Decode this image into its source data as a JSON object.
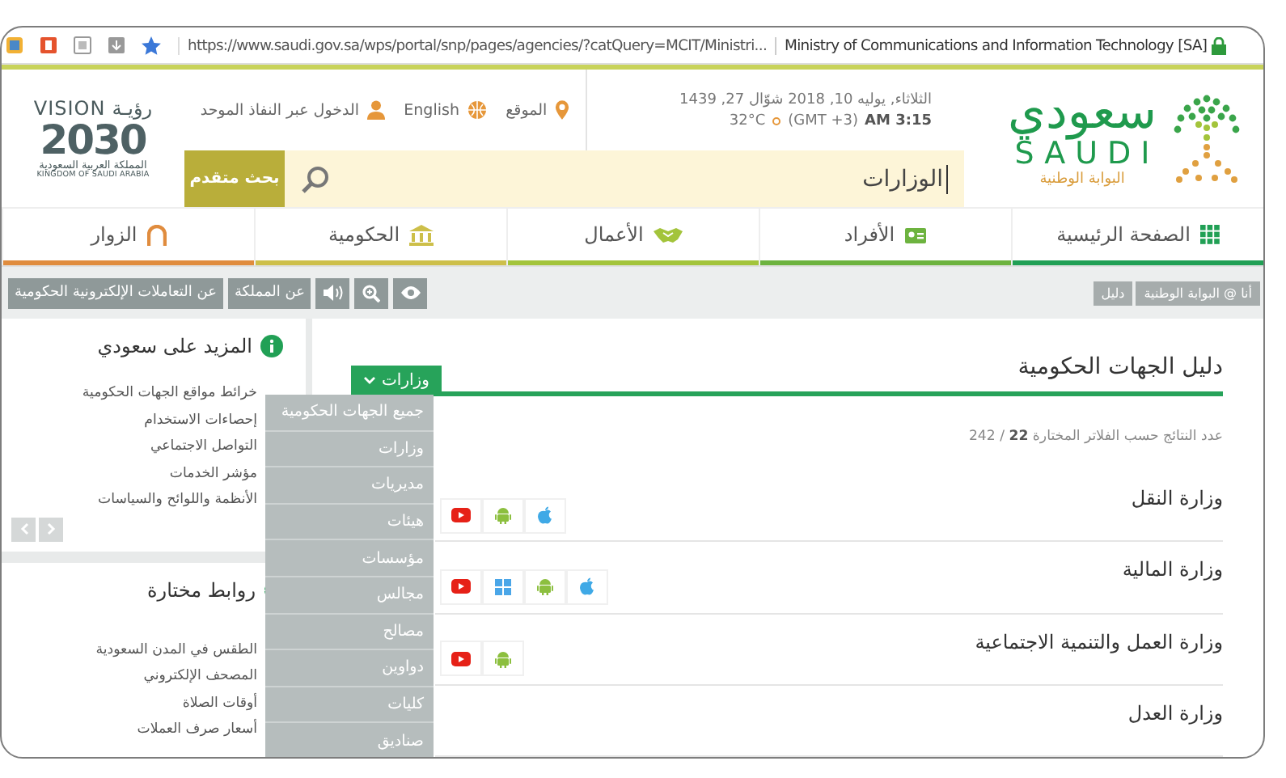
{
  "browser": {
    "url": "https://www.saudi.gov.sa/wps/portal/snp/pages/agencies/?catQuery=MCIT/Ministri...",
    "page_title": "Ministry of Communications and Information Technology [SA]"
  },
  "header": {
    "logo": {
      "name_ar": "سعودي",
      "name_en": "SAUDI",
      "subtitle": "البوابة الوطنية"
    },
    "date": "الثلاثاء, يوليه 10, 2018 شوّال 27, 1439",
    "temperature": "32°C",
    "timezone": "(GMT +3)",
    "time": "AM 3:15",
    "links": [
      {
        "kind": "location",
        "label": "الموقع"
      },
      {
        "kind": "language",
        "label": "English"
      },
      {
        "kind": "login",
        "label": "الدخول عبر النفاذ الموحد"
      }
    ],
    "search": {
      "value": "الوزارات"
    },
    "advanced_search": "بحث متقدم",
    "vision": {
      "title_en": "VISION",
      "title_ar": "رؤيـة",
      "year": "2030",
      "org_ar": "المملكة العربية السعودية",
      "org_en": "KINGDOM OF SAUDI ARABIA"
    }
  },
  "nav_tabs": [
    {
      "kind": "home",
      "label": "الصفحة الرئيسية",
      "color": "#21a055"
    },
    {
      "kind": "individuals",
      "label": "الأفراد",
      "color": "#6db33f"
    },
    {
      "kind": "business",
      "label": "الأعمال",
      "color": "#a3c43b"
    },
    {
      "kind": "government",
      "label": "الحكومية",
      "color": "#cdbf4a"
    },
    {
      "kind": "visitors",
      "label": "الزوار",
      "color": "#e08c3e"
    }
  ],
  "toolbar": {
    "buttons": [
      {
        "kind": "eye"
      },
      {
        "kind": "zoom"
      },
      {
        "kind": "speaker"
      },
      {
        "kind": "text",
        "label": "عن المملكة"
      },
      {
        "kind": "text",
        "label": "عن التعاملات الإلكترونية الحكومية"
      }
    ],
    "breadcrumb": [
      "أنا @ البوابة الوطنية",
      "دليل"
    ]
  },
  "sidebar": {
    "more": {
      "title": "المزيد على سعودي",
      "items": [
        "خرائط مواقع الجهات الحكومية",
        "إحصاءات الاستخدام",
        "التواصل الاجتماعي",
        "مؤشر الخدمات",
        "الأنظمة واللوائح والسياسات"
      ]
    },
    "links": {
      "title": "روابط مختارة",
      "items": [
        "الطقس في المدن السعودية",
        "المصحف الإلكتروني",
        "أوقات الصلاة",
        "أسعار صرف العملات"
      ]
    }
  },
  "main": {
    "title": "دليل الجهات الحكومية",
    "filter": {
      "label": "وزارات",
      "expanded": true,
      "options": [
        "جميع الجهات الحكومية",
        "وزارات",
        "مديريات",
        "هيئات",
        "مؤسسات",
        "مجالس",
        "مصالح",
        "دواوين",
        "كليات",
        "صناديق"
      ]
    },
    "result_count": "عدد النتائج حسب الفلاتر المختارة **22** / 242",
    "entities": [
      {
        "name": "وزارة النقل",
        "apps": [
          {
            "kind": "apple"
          },
          {
            "kind": "android"
          },
          {
            "kind": "youtube"
          }
        ]
      },
      {
        "name": "وزارة المالية",
        "apps": [
          {
            "kind": "apple"
          },
          {
            "kind": "android"
          },
          {
            "kind": "windows"
          },
          {
            "kind": "youtube"
          }
        ]
      },
      {
        "name": "وزارة العمل والتنمية الاجتماعية",
        "apps": [
          {
            "kind": "android"
          },
          {
            "kind": "youtube"
          }
        ]
      },
      {
        "name": "وزارة العدل"
      }
    ]
  }
}
